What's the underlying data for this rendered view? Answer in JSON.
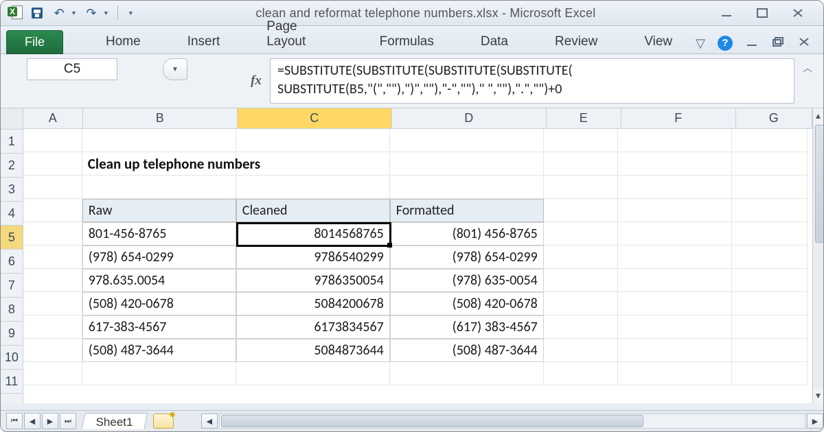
{
  "window": {
    "title": "clean and reformat telephone numbers.xlsx  -  Microsoft Excel"
  },
  "ribbon": {
    "file": "File",
    "tabs": [
      "Home",
      "Insert",
      "Page Layout",
      "Formulas",
      "Data",
      "Review",
      "View"
    ]
  },
  "namebox": "C5",
  "fx_label": "fx",
  "formula": "=SUBSTITUTE(SUBSTITUTE(SUBSTITUTE(SUBSTITUTE(\nSUBSTITUTE(B5,\"(\",\"\"),\")\",\"\"),\"-\",\"\"),\" \",\"\"),\".\",\"\")+0",
  "columns": [
    "A",
    "B",
    "C",
    "D",
    "E",
    "F",
    "G"
  ],
  "row_numbers": [
    "1",
    "2",
    "3",
    "4",
    "5",
    "6",
    "7",
    "8",
    "9",
    "10",
    "11"
  ],
  "sheet": {
    "title": "Clean up telephone numbers",
    "headers": {
      "raw": "Raw",
      "cleaned": "Cleaned",
      "formatted": "Formatted"
    },
    "rows": [
      {
        "raw": "801-456-8765",
        "cleaned": "8014568765",
        "formatted": "(801) 456-8765"
      },
      {
        "raw": "(978) 654-0299",
        "cleaned": "9786540299",
        "formatted": "(978) 654-0299"
      },
      {
        "raw": "978.635.0054",
        "cleaned": "9786350054",
        "formatted": "(978) 635-0054"
      },
      {
        "raw": "(508) 420-0678",
        "cleaned": "5084200678",
        "formatted": "(508) 420-0678"
      },
      {
        "raw": "617-383-4567",
        "cleaned": "6173834567",
        "formatted": "(617) 383-4567"
      },
      {
        "raw": "(508) 487-3644",
        "cleaned": "5084873644",
        "formatted": "(508) 487-3644"
      }
    ]
  },
  "active_cell": "C5",
  "tabs_bottom": {
    "sheet1": "Sheet1"
  }
}
